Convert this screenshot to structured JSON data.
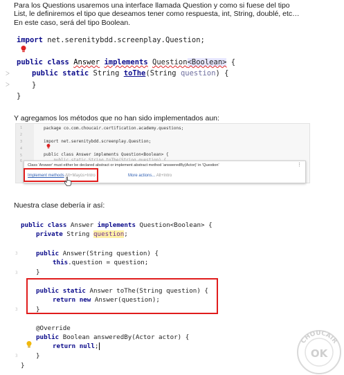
{
  "intro": {
    "line1": "Para los Questions usaremos una interface llamada Question y como si fuese del tipo",
    "line2": "List, le definiremos el tipo que deseamos tener como respuesta, int, String, doublé, etc…",
    "line3": "En este caso, será del tipo Boolean."
  },
  "code1": {
    "import_kw": "import",
    "import_rest": " net.serenitybdd.screenplay.Question;",
    "class_public": "public class",
    "class_name": "Answer",
    "class_impl": "implements",
    "class_iface": "Question",
    "class_generic": "<Boolean>",
    "class_brace": " {",
    "method_mods": "public static",
    "method_type": " String ",
    "method_name": "toThe",
    "method_params_open": "(String ",
    "method_param": "question",
    "method_params_close": ") {",
    "close_inner": "}",
    "close_outer": "}"
  },
  "section2": {
    "caption": "Y agregamos los métodos que no han sido implementados aun:",
    "package_line": "package co.com.choucair.certification.academy.questions;",
    "import_line": "import net.serenitybdd.screenplay.Question;",
    "class_line": "public class Answer implements Question<Boolean> {",
    "hidden_line": "    public static String toThe(String question) {",
    "popup_message": "Class 'Answer' must either be declared abstract or implement abstract method 'answeredBy(Actor)' in 'Question'",
    "popup_more": "⋮",
    "action_implement": "Implement methods",
    "action_implement_shortcut": "Alt+Mayús+Intro",
    "action_more": "More actions...",
    "action_more_shortcut": "Alt+Intro",
    "line_numbers": [
      "1",
      "2",
      "3",
      "4",
      "5",
      "6"
    ]
  },
  "section3": {
    "caption": "Nuestra clase debería ir así:",
    "lines": {
      "l1_kw": "public class",
      "l1_rest": " Answer ",
      "l1_impl": "implements",
      "l1_tail": " Question<Boolean> {",
      "l2_kw": "private",
      "l2_type": " String ",
      "l2_field": "question",
      "l2_end": ";",
      "l3_kw": "public",
      "l3_rest": " Answer(String question) {",
      "l4_kw": "this",
      "l4_rest": ".question = question;",
      "l5": "}",
      "l6_kw": "public static",
      "l6_rest": " Answer toThe(String question) {",
      "l7_kw": "return new",
      "l7_rest": " Answer(question);",
      "l8": "}",
      "l9": "@Override",
      "l10_kw": "public",
      "l10_rest": " Boolean answeredBy(Actor actor) {",
      "l11_kw": "return null",
      "l11_rest": ";",
      "l12": "}",
      "l13": "}"
    },
    "gutter_marks": [
      "3",
      "3",
      "3",
      "3"
    ]
  },
  "watermark": {
    "text": "CHOUCAIR",
    "badge": "OK"
  },
  "colors": {
    "keyword": "#0a0a8a",
    "highlight_red": "#e01b1b",
    "annotation": "#7d7d1e",
    "generic_highlight": "#e7e7ff"
  }
}
